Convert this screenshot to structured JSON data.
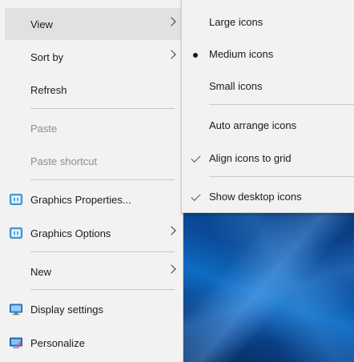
{
  "main_menu": {
    "items": [
      {
        "label": "View",
        "has_submenu": true,
        "state": "highlighted"
      },
      {
        "label": "Sort by",
        "has_submenu": true
      },
      {
        "label": "Refresh"
      },
      {
        "label": "Paste",
        "disabled": true
      },
      {
        "label": "Paste shortcut",
        "disabled": true
      },
      {
        "label": "Graphics Properties...",
        "icon": "intel-graphics-icon"
      },
      {
        "label": "Graphics Options",
        "icon": "intel-graphics-icon",
        "has_submenu": true
      },
      {
        "label": "New",
        "has_submenu": true
      },
      {
        "label": "Display settings",
        "icon": "display-settings-icon"
      },
      {
        "label": "Personalize",
        "icon": "personalize-icon"
      }
    ]
  },
  "view_submenu": {
    "items": [
      {
        "label": "Large icons"
      },
      {
        "label": "Medium icons",
        "mark": "bullet"
      },
      {
        "label": "Small icons"
      },
      {
        "label": "Auto arrange icons"
      },
      {
        "label": "Align icons to grid",
        "mark": "check"
      },
      {
        "label": "Show desktop icons",
        "mark": "check"
      }
    ]
  },
  "colors": {
    "menu_bg": "#f2f2f2",
    "highlight_bg": "#e1e1e1",
    "disabled_text": "#8d8d8d",
    "text": "#1a1a1a",
    "desktop_blue": "#0a4a98"
  }
}
